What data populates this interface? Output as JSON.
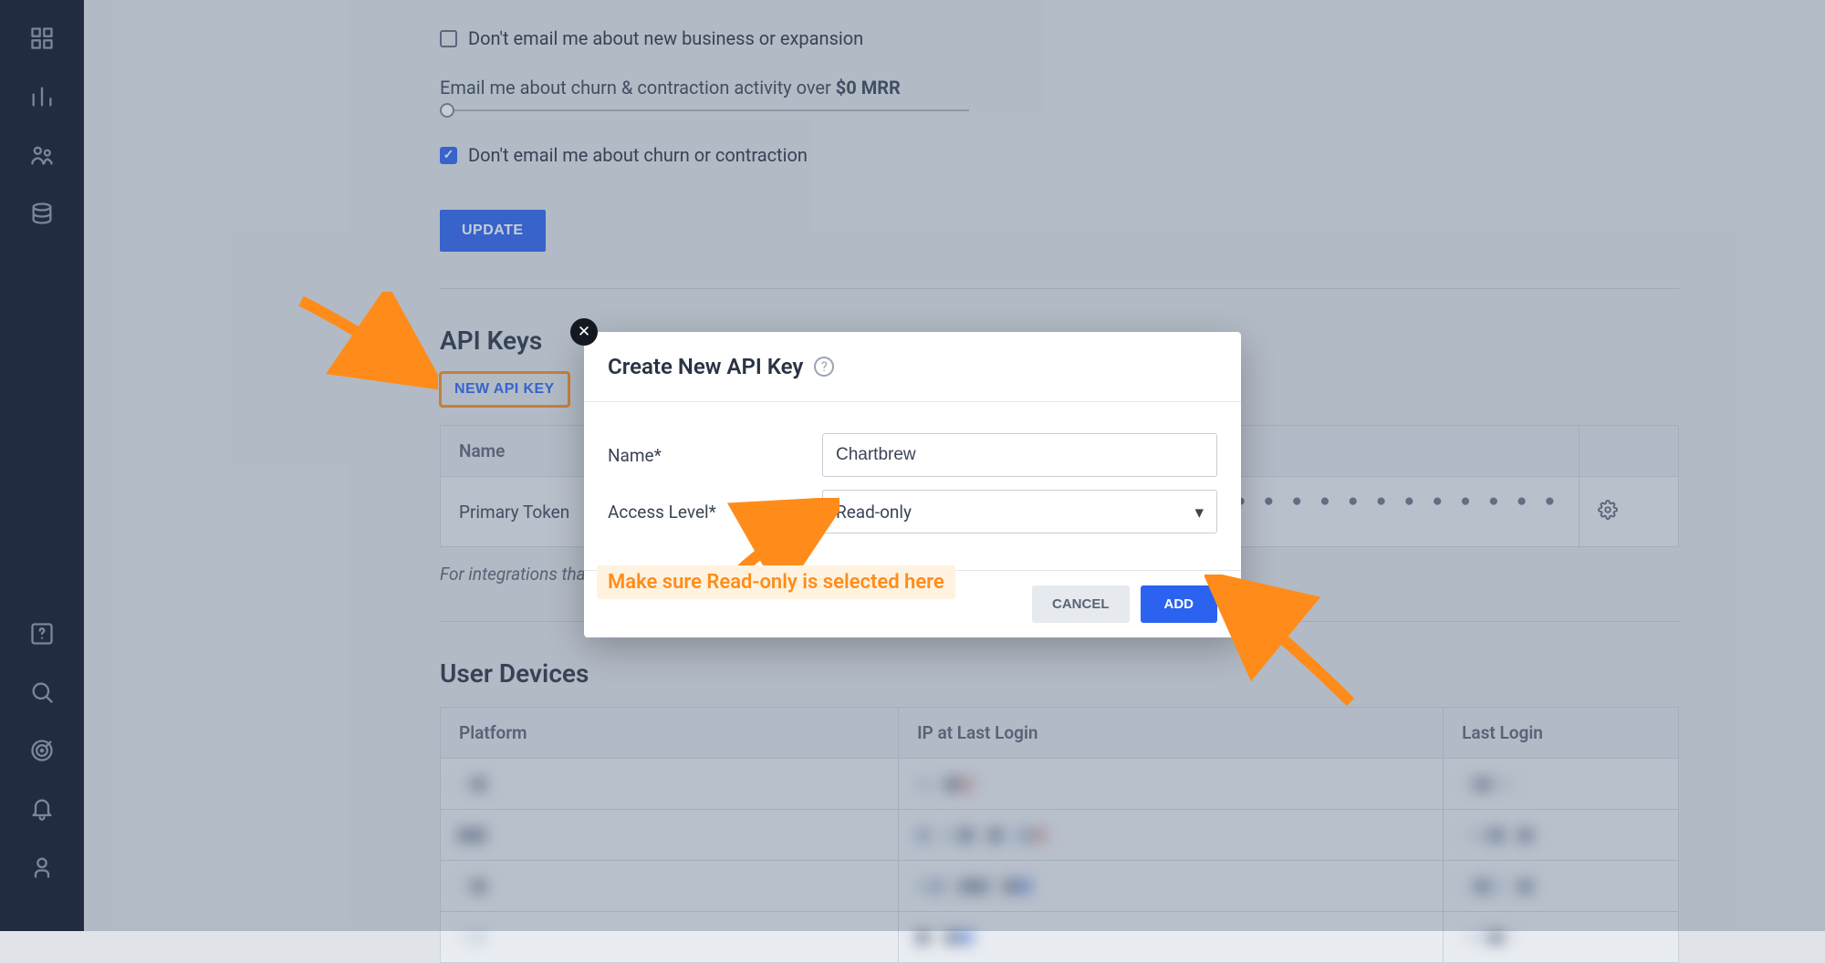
{
  "settings": {
    "chk_business": "Don't email me about new business or expansion",
    "slider_label": "Email me about churn & contraction activity over",
    "slider_value": "$0 MRR",
    "chk_churn": "Don't email me about churn or contraction",
    "update_btn": "UPDATE"
  },
  "api_keys": {
    "heading": "API Keys",
    "new_btn": "NEW API KEY",
    "col_name": "Name",
    "row_name": "Primary Token",
    "row_key": "● ● ● ● ● ● ● ● ● ● ● ● ● ● ● ● ● ● ● ● ● ● ● ● ● ● ● ● ● ● ●",
    "hint": "For integrations that"
  },
  "devices": {
    "heading": "User Devices",
    "col_platform": "Platform",
    "col_ip": "IP at Last Login",
    "col_last": "Last Login"
  },
  "modal": {
    "title": "Create New API Key",
    "name_label": "Name*",
    "name_value": "Chartbrew",
    "access_label": "Access Level*",
    "access_value": "Read-only",
    "cancel": "CANCEL",
    "add": "ADD"
  },
  "annotation": {
    "note": "Make sure Read-only is selected here"
  }
}
